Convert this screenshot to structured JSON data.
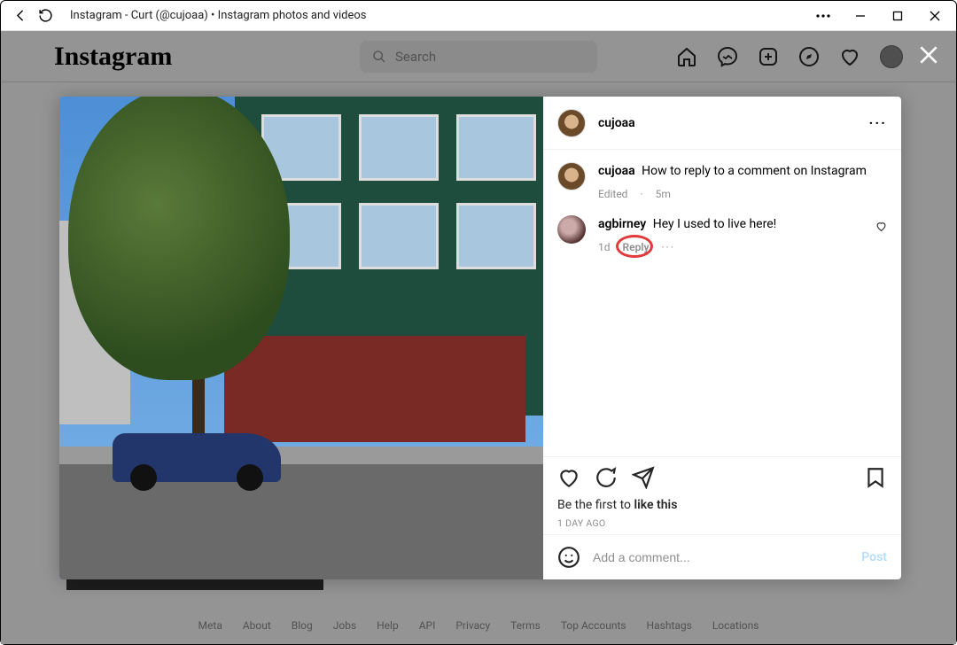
{
  "window": {
    "title": "Instagram - Curt (@cujoaa) • Instagram photos and videos"
  },
  "header": {
    "logo": "Instagram",
    "search_placeholder": "Search"
  },
  "post": {
    "author": "cujoaa",
    "caption_author": "cujoaa",
    "caption_text": "How to reply to a comment on Instagram",
    "caption_meta_edited": "Edited",
    "caption_meta_time": "5m",
    "likes_prefix": "Be the first to ",
    "likes_action": "like this",
    "age": "1 DAY AGO",
    "comment_placeholder": "Add a comment...",
    "post_button": "Post"
  },
  "comments": [
    {
      "author": "agbirney",
      "text": "Hey I used to live here!",
      "time": "1d",
      "reply_label": "Reply"
    }
  ],
  "footer": {
    "links": [
      "Meta",
      "About",
      "Blog",
      "Jobs",
      "Help",
      "API",
      "Privacy",
      "Terms",
      "Top Accounts",
      "Hashtags",
      "Locations"
    ]
  }
}
